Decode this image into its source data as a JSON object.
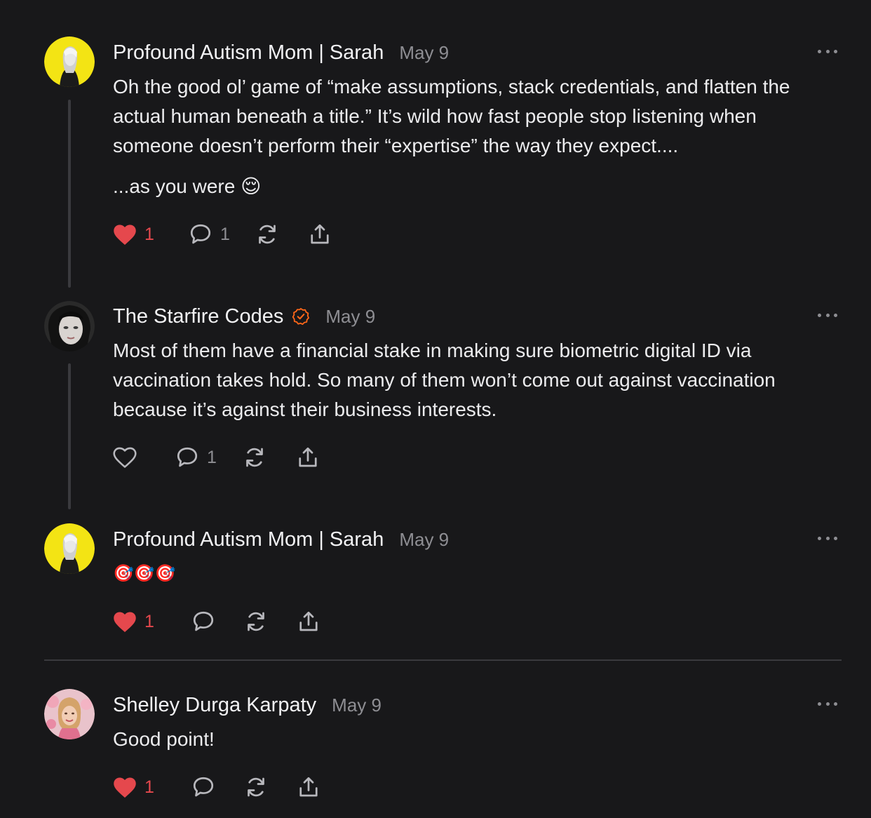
{
  "comments": [
    {
      "author": "Profound Autism Mom | Sarah",
      "date": "May 9",
      "body": [
        "Oh the good ol’ game of “make assumptions, stack credentials, and flatten the actual human beneath a title.” It’s wild how fast people stop listening when someone doesn’t perform their “expertise” the way they expect....",
        "...as you were 😌"
      ],
      "likes": "1",
      "liked": true,
      "replies": "1"
    },
    {
      "author": "The Starfire Codes",
      "verified": true,
      "date": "May 9",
      "body": [
        "Most of them have a financial stake in making sure biometric digital ID via vaccination takes hold. So many of them won’t come out against vaccination because it’s against their business interests."
      ],
      "likes": "",
      "liked": false,
      "replies": "1"
    },
    {
      "author": "Profound Autism Mom | Sarah",
      "date": "May 9",
      "body": [
        "🎯🎯🎯"
      ],
      "likes": "1",
      "liked": true,
      "replies": ""
    },
    {
      "author": "Shelley Durga Karpaty",
      "date": "May 9",
      "body": [
        "Good point!"
      ],
      "likes": "1",
      "liked": true,
      "replies": ""
    }
  ],
  "colors": {
    "background": "#18181a",
    "like_red": "#e5484d",
    "verified_orange": "#ff6719",
    "muted": "#8e8e93"
  },
  "icons": [
    "heart-icon",
    "comment-icon",
    "restack-icon",
    "share-icon",
    "more-icon",
    "verified-icon"
  ]
}
